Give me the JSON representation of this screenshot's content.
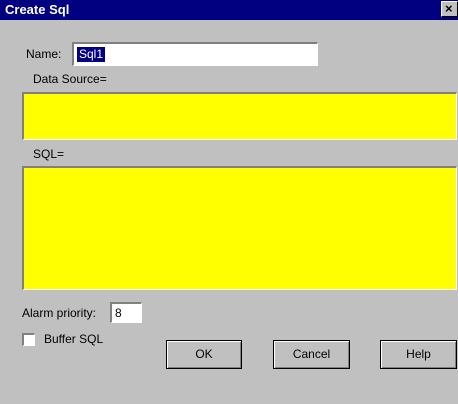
{
  "window": {
    "title": "Create Sql",
    "close_glyph": "×"
  },
  "name_field": {
    "label": "Name:",
    "value": "Sql1"
  },
  "data_source": {
    "label": "Data Source=",
    "value": ""
  },
  "sql": {
    "label": "SQL=",
    "value": ""
  },
  "alarm_priority": {
    "label": "Alarm priority:",
    "value": "8"
  },
  "buffer_sql": {
    "label": "Buffer SQL",
    "checked": false
  },
  "buttons": {
    "ok": "OK",
    "cancel": "Cancel",
    "help": "Help"
  },
  "colors": {
    "titlebar": "#000080",
    "dialog_bg": "#c0c0c0",
    "field_highlight": "#ffff00"
  },
  "icons": {
    "close": "close-icon"
  }
}
